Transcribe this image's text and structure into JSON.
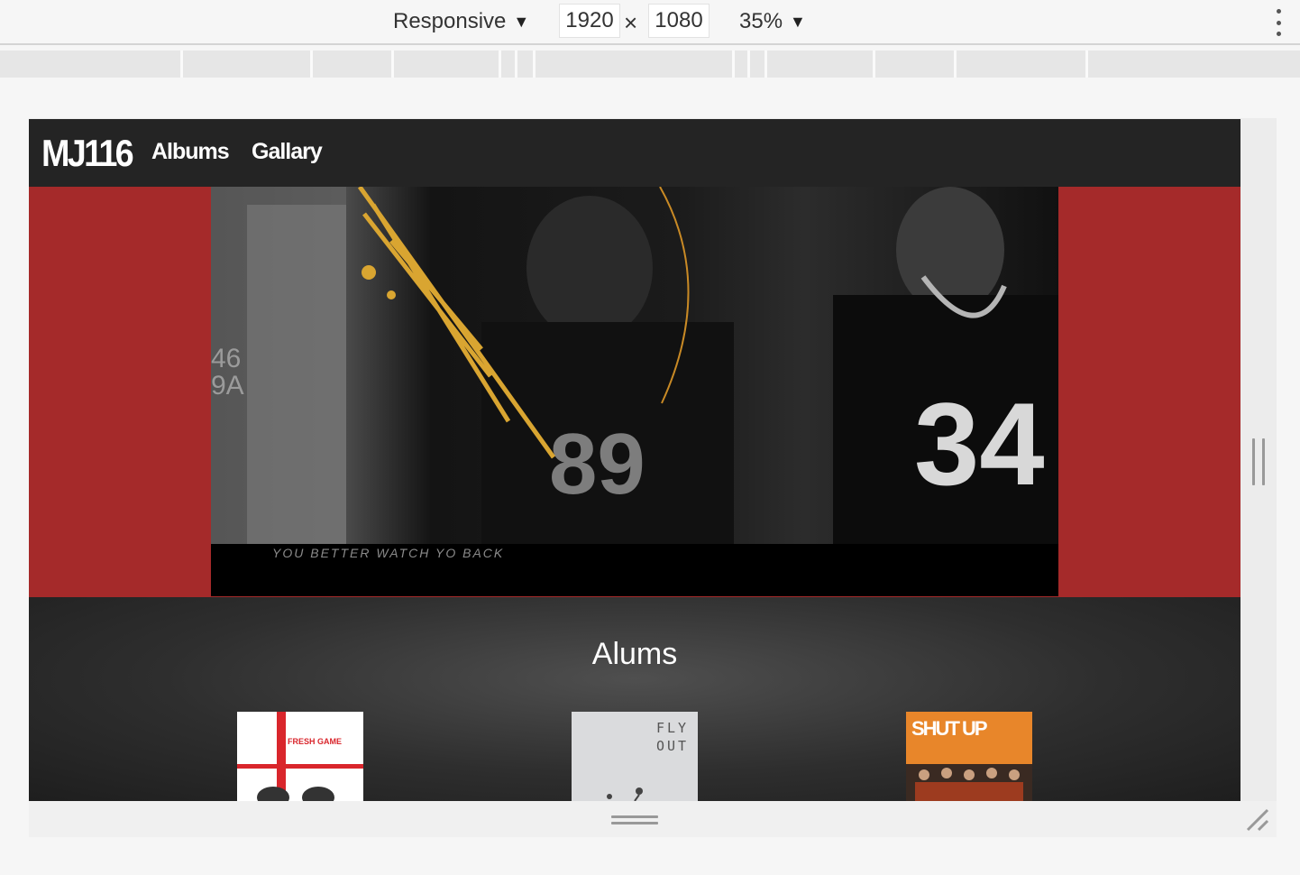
{
  "devtools": {
    "device_mode": "Responsive",
    "width": "1920",
    "times": "×",
    "height": "1080",
    "zoom": "35%",
    "dropdown_arrow": "▼",
    "more_icon": "kebab-menu-icon"
  },
  "site": {
    "brand": "MJ116",
    "nav": [
      "Albums",
      "Gallary"
    ],
    "hero_color": "#a52a2a",
    "video_subtitle": "YOU   BETTER   WATCH YO BACK",
    "albums_title": "Alums"
  },
  "album_covers": [
    {
      "cover_text": "FRESH GAME",
      "accent": "#d9262c"
    },
    {
      "cover_text": "FLY OUT",
      "accent": "#dcdcdc"
    },
    {
      "cover_text": "SHUT UP",
      "accent": "#e8862a"
    }
  ]
}
